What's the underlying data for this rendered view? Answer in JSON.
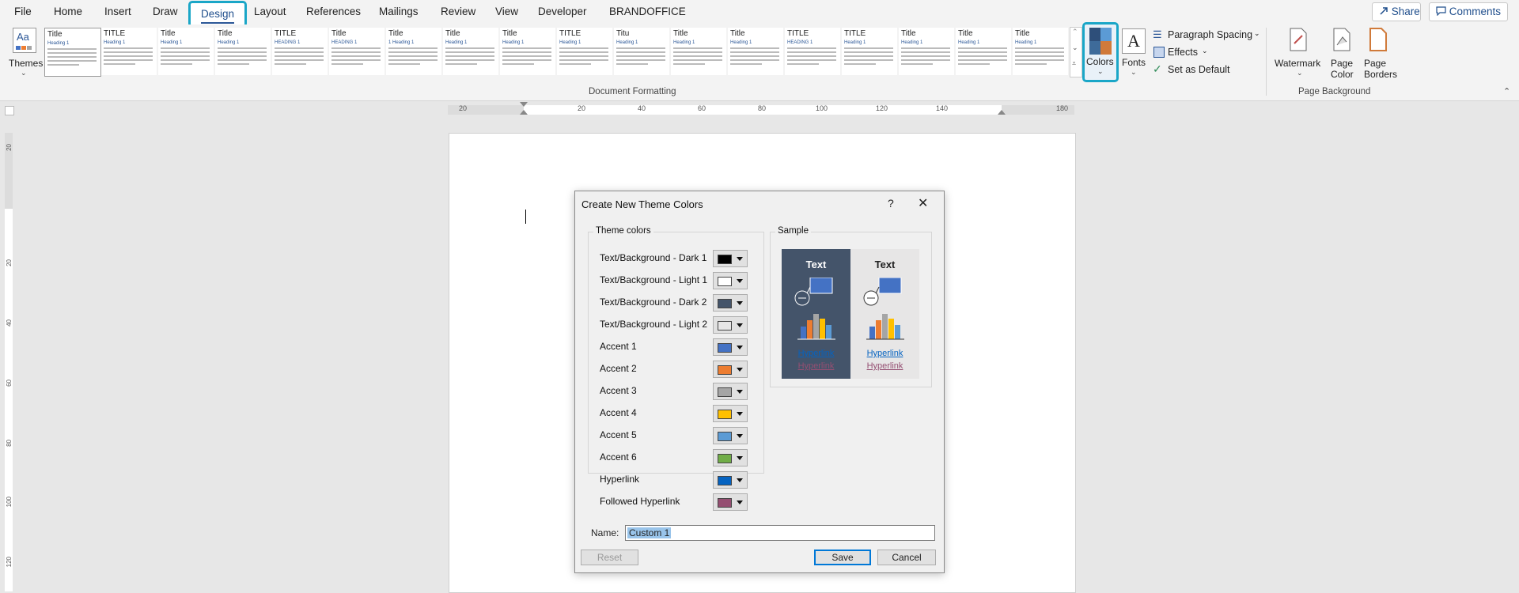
{
  "menu": {
    "items": [
      "File",
      "Home",
      "Insert",
      "Draw",
      "Design",
      "Layout",
      "References",
      "Mailings",
      "Review",
      "View",
      "Developer",
      "BRANDOFFICE"
    ],
    "share_label": "Share",
    "comments_label": "Comments"
  },
  "ribbon": {
    "themes_label": "Themes",
    "group_document_formatting": "Document Formatting",
    "colors_label": "Colors",
    "fonts_label": "Fonts",
    "paragraph_spacing_label": "Paragraph Spacing",
    "effects_label": "Effects",
    "set_as_default_label": "Set as Default",
    "watermark_label": "Watermark",
    "page_color_label": "Page Color",
    "page_borders_label": "Page Borders",
    "group_page_background": "Page Background",
    "gallery": [
      {
        "title": "Title",
        "heading": "Heading 1"
      },
      {
        "title": "TITLE",
        "heading": "Heading 1"
      },
      {
        "title": "Title",
        "heading": "Heading 1"
      },
      {
        "title": "Title",
        "heading": "Heading 1"
      },
      {
        "title": "TITLE",
        "heading": "HEADING 1"
      },
      {
        "title": "Title",
        "heading": "HEADING 1"
      },
      {
        "title": "Title",
        "heading": "1 Heading 1"
      },
      {
        "title": "Title",
        "heading": "Heading 1"
      },
      {
        "title": "Title",
        "heading": "Heading 1"
      },
      {
        "title": "TITLE",
        "heading": "Heading 1"
      },
      {
        "title": "Titu",
        "heading": "Heading 1"
      },
      {
        "title": "Title",
        "heading": "Heading 1"
      },
      {
        "title": "Title",
        "heading": "Heading 1"
      },
      {
        "title": "TITLE",
        "heading": "HEADING 1"
      },
      {
        "title": "TITLE",
        "heading": "Heading 1"
      },
      {
        "title": "Title",
        "heading": "Heading 1"
      },
      {
        "title": "Title",
        "heading": "Heading 1"
      },
      {
        "title": "Title",
        "heading": "Heading 1"
      }
    ]
  },
  "ruler": {
    "h_ticks": [
      "20",
      "20",
      "40",
      "60",
      "80",
      "100",
      "120",
      "140",
      "180"
    ],
    "v_ticks": [
      "20",
      "20",
      "40",
      "60",
      "80",
      "100",
      "120"
    ]
  },
  "dialog": {
    "title": "Create New Theme Colors",
    "help": "?",
    "close": "✕",
    "theme_colors_legend": "Theme colors",
    "sample_legend": "Sample",
    "rows": [
      {
        "label": "Text/Background - Dark 1",
        "color": "#000000"
      },
      {
        "label": "Text/Background - Light 1",
        "color": "#ffffff"
      },
      {
        "label": "Text/Background - Dark 2",
        "color": "#44546a"
      },
      {
        "label": "Text/Background - Light 2",
        "color": "#e7e6e6"
      },
      {
        "label": "Accent 1",
        "color": "#4472c4"
      },
      {
        "label": "Accent 2",
        "color": "#ed7d31"
      },
      {
        "label": "Accent 3",
        "color": "#a5a5a5"
      },
      {
        "label": "Accent 4",
        "color": "#ffc000"
      },
      {
        "label": "Accent 5",
        "color": "#5b9bd5"
      },
      {
        "label": "Accent 6",
        "color": "#70ad47"
      },
      {
        "label": "Hyperlink",
        "color": "#0563c1"
      },
      {
        "label": "Followed Hyperlink",
        "color": "#954f72"
      }
    ],
    "sample": {
      "text_dark": "Text",
      "text_light": "Text",
      "hyperlink": "Hyperlink",
      "followed_hyperlink": "Hyperlink"
    },
    "name_label": "Name:",
    "name_value": "Custom 1",
    "reset_label": "Reset",
    "save_label": "Save",
    "cancel_label": "Cancel"
  },
  "colors": {
    "accent_highlight": "#1aa6c7",
    "dark_panel": "#44546a",
    "light_panel": "#e7e6e6"
  }
}
